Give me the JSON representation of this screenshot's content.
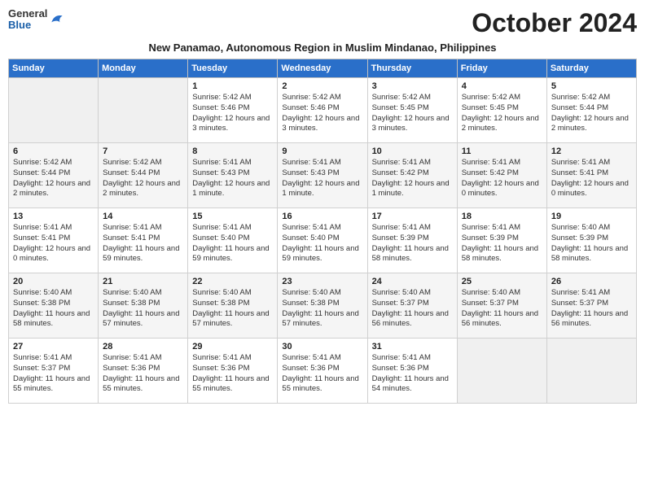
{
  "logo": {
    "general": "General",
    "blue": "Blue"
  },
  "title": "October 2024",
  "subtitle": "New Panamao, Autonomous Region in Muslim Mindanao, Philippines",
  "headers": [
    "Sunday",
    "Monday",
    "Tuesday",
    "Wednesday",
    "Thursday",
    "Friday",
    "Saturday"
  ],
  "weeks": [
    [
      {
        "day": "",
        "info": ""
      },
      {
        "day": "",
        "info": ""
      },
      {
        "day": "1",
        "info": "Sunrise: 5:42 AM\nSunset: 5:46 PM\nDaylight: 12 hours and 3 minutes."
      },
      {
        "day": "2",
        "info": "Sunrise: 5:42 AM\nSunset: 5:46 PM\nDaylight: 12 hours and 3 minutes."
      },
      {
        "day": "3",
        "info": "Sunrise: 5:42 AM\nSunset: 5:45 PM\nDaylight: 12 hours and 3 minutes."
      },
      {
        "day": "4",
        "info": "Sunrise: 5:42 AM\nSunset: 5:45 PM\nDaylight: 12 hours and 2 minutes."
      },
      {
        "day": "5",
        "info": "Sunrise: 5:42 AM\nSunset: 5:44 PM\nDaylight: 12 hours and 2 minutes."
      }
    ],
    [
      {
        "day": "6",
        "info": "Sunrise: 5:42 AM\nSunset: 5:44 PM\nDaylight: 12 hours and 2 minutes."
      },
      {
        "day": "7",
        "info": "Sunrise: 5:42 AM\nSunset: 5:44 PM\nDaylight: 12 hours and 2 minutes."
      },
      {
        "day": "8",
        "info": "Sunrise: 5:41 AM\nSunset: 5:43 PM\nDaylight: 12 hours and 1 minute."
      },
      {
        "day": "9",
        "info": "Sunrise: 5:41 AM\nSunset: 5:43 PM\nDaylight: 12 hours and 1 minute."
      },
      {
        "day": "10",
        "info": "Sunrise: 5:41 AM\nSunset: 5:42 PM\nDaylight: 12 hours and 1 minute."
      },
      {
        "day": "11",
        "info": "Sunrise: 5:41 AM\nSunset: 5:42 PM\nDaylight: 12 hours and 0 minutes."
      },
      {
        "day": "12",
        "info": "Sunrise: 5:41 AM\nSunset: 5:41 PM\nDaylight: 12 hours and 0 minutes."
      }
    ],
    [
      {
        "day": "13",
        "info": "Sunrise: 5:41 AM\nSunset: 5:41 PM\nDaylight: 12 hours and 0 minutes."
      },
      {
        "day": "14",
        "info": "Sunrise: 5:41 AM\nSunset: 5:41 PM\nDaylight: 11 hours and 59 minutes."
      },
      {
        "day": "15",
        "info": "Sunrise: 5:41 AM\nSunset: 5:40 PM\nDaylight: 11 hours and 59 minutes."
      },
      {
        "day": "16",
        "info": "Sunrise: 5:41 AM\nSunset: 5:40 PM\nDaylight: 11 hours and 59 minutes."
      },
      {
        "day": "17",
        "info": "Sunrise: 5:41 AM\nSunset: 5:39 PM\nDaylight: 11 hours and 58 minutes."
      },
      {
        "day": "18",
        "info": "Sunrise: 5:41 AM\nSunset: 5:39 PM\nDaylight: 11 hours and 58 minutes."
      },
      {
        "day": "19",
        "info": "Sunrise: 5:40 AM\nSunset: 5:39 PM\nDaylight: 11 hours and 58 minutes."
      }
    ],
    [
      {
        "day": "20",
        "info": "Sunrise: 5:40 AM\nSunset: 5:38 PM\nDaylight: 11 hours and 58 minutes."
      },
      {
        "day": "21",
        "info": "Sunrise: 5:40 AM\nSunset: 5:38 PM\nDaylight: 11 hours and 57 minutes."
      },
      {
        "day": "22",
        "info": "Sunrise: 5:40 AM\nSunset: 5:38 PM\nDaylight: 11 hours and 57 minutes."
      },
      {
        "day": "23",
        "info": "Sunrise: 5:40 AM\nSunset: 5:38 PM\nDaylight: 11 hours and 57 minutes."
      },
      {
        "day": "24",
        "info": "Sunrise: 5:40 AM\nSunset: 5:37 PM\nDaylight: 11 hours and 56 minutes."
      },
      {
        "day": "25",
        "info": "Sunrise: 5:40 AM\nSunset: 5:37 PM\nDaylight: 11 hours and 56 minutes."
      },
      {
        "day": "26",
        "info": "Sunrise: 5:41 AM\nSunset: 5:37 PM\nDaylight: 11 hours and 56 minutes."
      }
    ],
    [
      {
        "day": "27",
        "info": "Sunrise: 5:41 AM\nSunset: 5:37 PM\nDaylight: 11 hours and 55 minutes."
      },
      {
        "day": "28",
        "info": "Sunrise: 5:41 AM\nSunset: 5:36 PM\nDaylight: 11 hours and 55 minutes."
      },
      {
        "day": "29",
        "info": "Sunrise: 5:41 AM\nSunset: 5:36 PM\nDaylight: 11 hours and 55 minutes."
      },
      {
        "day": "30",
        "info": "Sunrise: 5:41 AM\nSunset: 5:36 PM\nDaylight: 11 hours and 55 minutes."
      },
      {
        "day": "31",
        "info": "Sunrise: 5:41 AM\nSunset: 5:36 PM\nDaylight: 11 hours and 54 minutes."
      },
      {
        "day": "",
        "info": ""
      },
      {
        "day": "",
        "info": ""
      }
    ]
  ]
}
